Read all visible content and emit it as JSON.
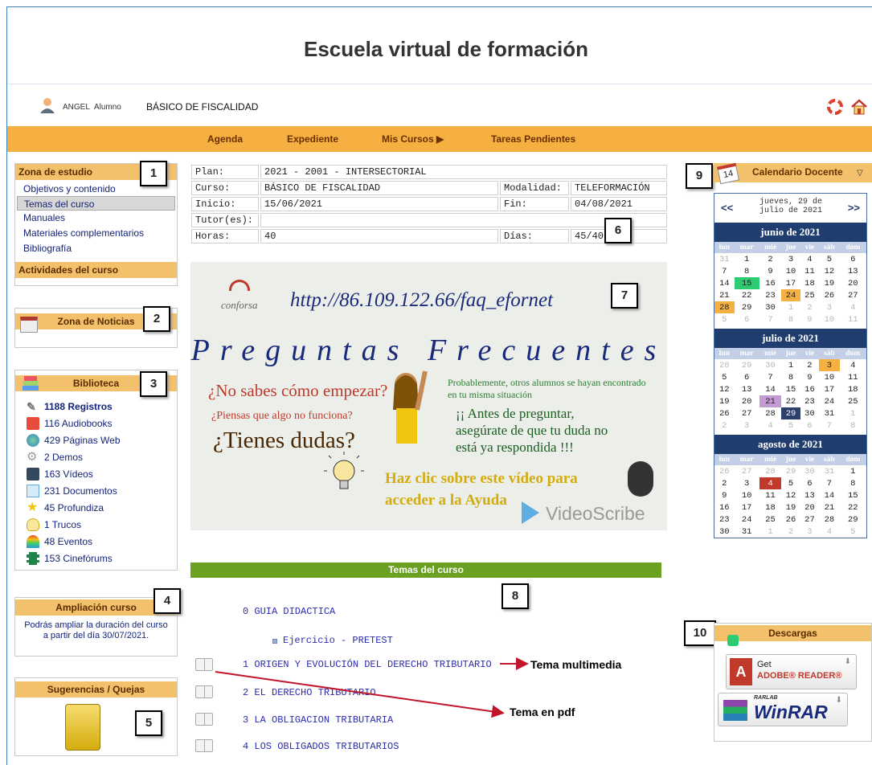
{
  "header": {
    "title": "Escuela virtual de formación"
  },
  "user": {
    "name": "ANGEL",
    "role": "Alumno",
    "course": "BÁSICO DE FISCALIDAD"
  },
  "nav": {
    "items": [
      "Agenda",
      "Expediente",
      "Mis Cursos",
      "Tareas Pendientes"
    ]
  },
  "sidebar": {
    "zona_estudio": {
      "title": "Zona de estudio",
      "items": [
        "Objetivos y contenido",
        "Temas del curso",
        "Manuales",
        "Materiales complementarios",
        "Bibliografía"
      ],
      "selected": 1,
      "actividades": "Actividades del curso"
    },
    "noticias": {
      "title": "Zona de Noticias"
    },
    "biblioteca": {
      "title": "Biblioteca",
      "items": [
        "1188 Registros",
        "116 Audiobooks",
        "429 Páginas Web",
        "2 Demos",
        "163 Vídeos",
        "231 Documentos",
        "45 Profundiza",
        "1 Trucos",
        "48 Eventos",
        "153 Cinefórums"
      ]
    },
    "ampliacion": {
      "title": "Ampliación curso",
      "text": "Podrás ampliar la duración del curso a partir del día 30/07/2021."
    },
    "sugerencias": {
      "title": "Sugerencias / Quejas"
    }
  },
  "info": {
    "plan_label": "Plan:",
    "plan": "2021 - 2001 - INTERSECTORIAL",
    "curso_label": "Curso:",
    "curso": "BÁSICO DE FISCALIDAD",
    "modalidad_label": "Modalidad:",
    "modalidad": "TELEFORMACIÓN",
    "inicio_label": "Inicio:",
    "inicio": "15/06/2021",
    "fin_label": "Fin:",
    "fin": "04/08/2021",
    "tutor_label": "Tutor(es):",
    "tutor": "",
    "horas_label": "Horas:",
    "horas": "40",
    "dias_label": "Días:",
    "dias": "45/40"
  },
  "video": {
    "url": "http://86.109.122.66/faq_efornet",
    "logo": "conforsa",
    "title": "Preguntas Frecuentes",
    "q1": "¿No sabes cómo empezar?",
    "q2": "¿Piensas que algo no funciona?",
    "q3": "¿Tienes dudas?",
    "p1": "Probablemente, otros alumnos se hayan encontrado en tu misma situación",
    "p2": "¡¡ Antes de preguntar, asegúrate de que tu duda no está ya respondida !!!",
    "cta": "Haz clic sobre este vídeo para acceder a la Ayuda",
    "watermark": "VideoScribe"
  },
  "temas": {
    "title": "Temas del curso",
    "items": [
      "0 GUIA DIDACTICA",
      "Ejercicio - PRETEST",
      "1 ORIGEN Y EVOLUCIÓN DEL DERECHO TRIBUTARIO",
      "2 EL DERECHO TRIBUTARIO",
      "3 LA OBLIGACION TRIBUTARIA",
      "4 LOS OBLIGADOS TRIBUTARIOS"
    ]
  },
  "annotations": {
    "multimedia": "Tema multimedia",
    "pdf": "Tema en pdf",
    "numbers": [
      "1",
      "2",
      "3",
      "4",
      "5",
      "6",
      "7",
      "8",
      "9",
      "10"
    ]
  },
  "calendar": {
    "title": "Calendario Docente",
    "date_label": "jueves, 29 de julio de 2021",
    "prev": "<<",
    "next": ">>",
    "weekdays": [
      "lun",
      "mar",
      "mié",
      "jue",
      "vie",
      "sáb",
      "dom"
    ],
    "months": [
      {
        "name": "junio de 2021",
        "weeks": [
          [
            "31",
            "1",
            "2",
            "3",
            "4",
            "5",
            "6"
          ],
          [
            "7",
            "8",
            "9",
            "10",
            "11",
            "12",
            "13"
          ],
          [
            "14",
            "15",
            "16",
            "17",
            "18",
            "19",
            "20"
          ],
          [
            "21",
            "22",
            "23",
            "24",
            "25",
            "26",
            "27"
          ],
          [
            "28",
            "29",
            "30",
            "1",
            "2",
            "3",
            "4"
          ],
          [
            "5",
            "6",
            "7",
            "8",
            "9",
            "10",
            "11"
          ]
        ]
      },
      {
        "name": "julio de 2021",
        "weeks": [
          [
            "28",
            "29",
            "30",
            "1",
            "2",
            "3",
            "4"
          ],
          [
            "5",
            "6",
            "7",
            "8",
            "9",
            "10",
            "11"
          ],
          [
            "12",
            "13",
            "14",
            "15",
            "16",
            "17",
            "18"
          ],
          [
            "19",
            "20",
            "21",
            "22",
            "23",
            "24",
            "25"
          ],
          [
            "26",
            "27",
            "28",
            "29",
            "30",
            "31",
            "1"
          ],
          [
            "2",
            "3",
            "4",
            "5",
            "6",
            "7",
            "8"
          ]
        ]
      },
      {
        "name": "agosto de 2021",
        "weeks": [
          [
            "26",
            "27",
            "28",
            "29",
            "30",
            "31",
            "1"
          ],
          [
            "2",
            "3",
            "4",
            "5",
            "6",
            "7",
            "8"
          ],
          [
            "9",
            "10",
            "11",
            "12",
            "13",
            "14",
            "15"
          ],
          [
            "16",
            "17",
            "18",
            "19",
            "20",
            "21",
            "22"
          ],
          [
            "23",
            "24",
            "25",
            "26",
            "27",
            "28",
            "29"
          ],
          [
            "30",
            "31",
            "1",
            "2",
            "3",
            "4",
            "5"
          ]
        ]
      }
    ]
  },
  "descargas": {
    "title": "Descargas",
    "adobe_get": "Get",
    "adobe_name": "ADOBE® READER®",
    "winrar_brand": "RARLAB",
    "winrar_name": "WinRAR"
  },
  "colors": {
    "accent": "#f5b041",
    "green_bar": "#6aa121",
    "calendar_blue": "#1f3d6e",
    "today": "#2d3f6b"
  }
}
